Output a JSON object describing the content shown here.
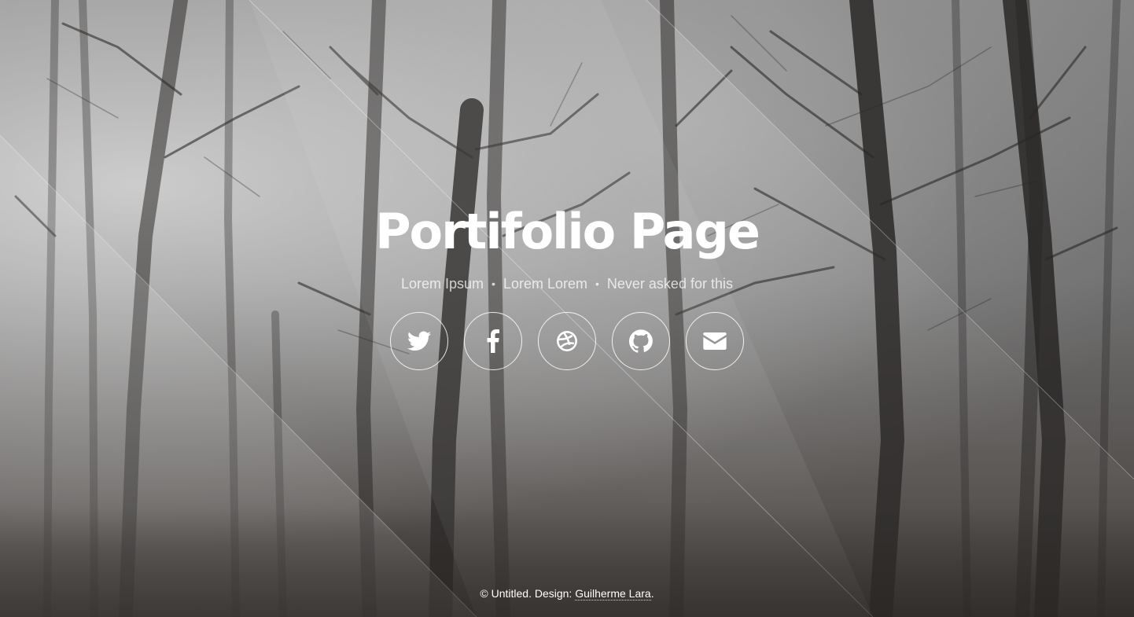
{
  "hero": {
    "title": "Portifolio Page",
    "subtitle_items": [
      "Lorem Ipsum",
      "Lorem Lorem",
      "Never asked for this"
    ],
    "subtitle_separator": "•"
  },
  "social": [
    {
      "name": "twitter",
      "icon": "twitter-icon"
    },
    {
      "name": "facebook",
      "icon": "facebook-icon"
    },
    {
      "name": "dribbble",
      "icon": "dribbble-icon"
    },
    {
      "name": "github",
      "icon": "github-icon"
    },
    {
      "name": "email",
      "icon": "envelope-icon"
    }
  ],
  "footer": {
    "prefix": "© Untitled. Design: ",
    "link_text": "Guilherme Lara",
    "suffix": "."
  },
  "colors": {
    "text": "#ffffff",
    "subtitle": "#d9d9d9"
  }
}
